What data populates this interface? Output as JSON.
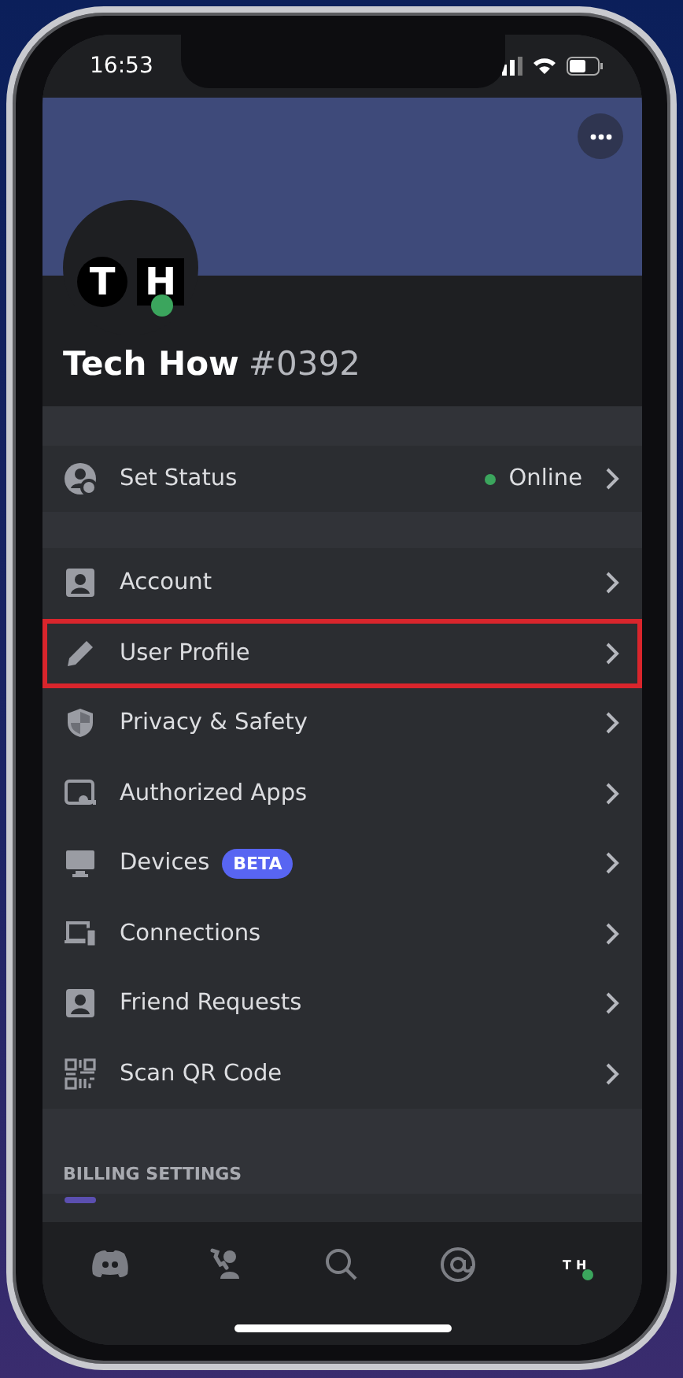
{
  "status_bar": {
    "time": "16:53"
  },
  "profile": {
    "avatar_letters": [
      "T",
      "H"
    ],
    "name": "Tech How",
    "tag": "#0392",
    "online": true
  },
  "status_row": {
    "label": "Set Status",
    "value": "Online"
  },
  "items": [
    {
      "kind": "person",
      "label": "Account",
      "highlighted": false
    },
    {
      "kind": "pencil",
      "label": "User Profile",
      "highlighted": true
    },
    {
      "kind": "shield",
      "label": "Privacy & Safety",
      "highlighted": false
    },
    {
      "kind": "apps",
      "label": "Authorized Apps",
      "highlighted": false
    },
    {
      "kind": "monitor",
      "label": "Devices",
      "badge": "BETA",
      "highlighted": false
    },
    {
      "kind": "devices",
      "label": "Connections",
      "highlighted": false
    },
    {
      "kind": "person",
      "label": "Friend Requests",
      "highlighted": false
    },
    {
      "kind": "qr",
      "label": "Scan QR Code",
      "highlighted": false
    }
  ],
  "billing_header": "BILLING SETTINGS",
  "tab_bar": [
    {
      "kind": "home",
      "selected": false
    },
    {
      "kind": "friends",
      "selected": false
    },
    {
      "kind": "search",
      "selected": false
    },
    {
      "kind": "mentions",
      "selected": false
    },
    {
      "kind": "profile",
      "selected": true,
      "avatar_letters": [
        "T",
        "H"
      ]
    }
  ]
}
